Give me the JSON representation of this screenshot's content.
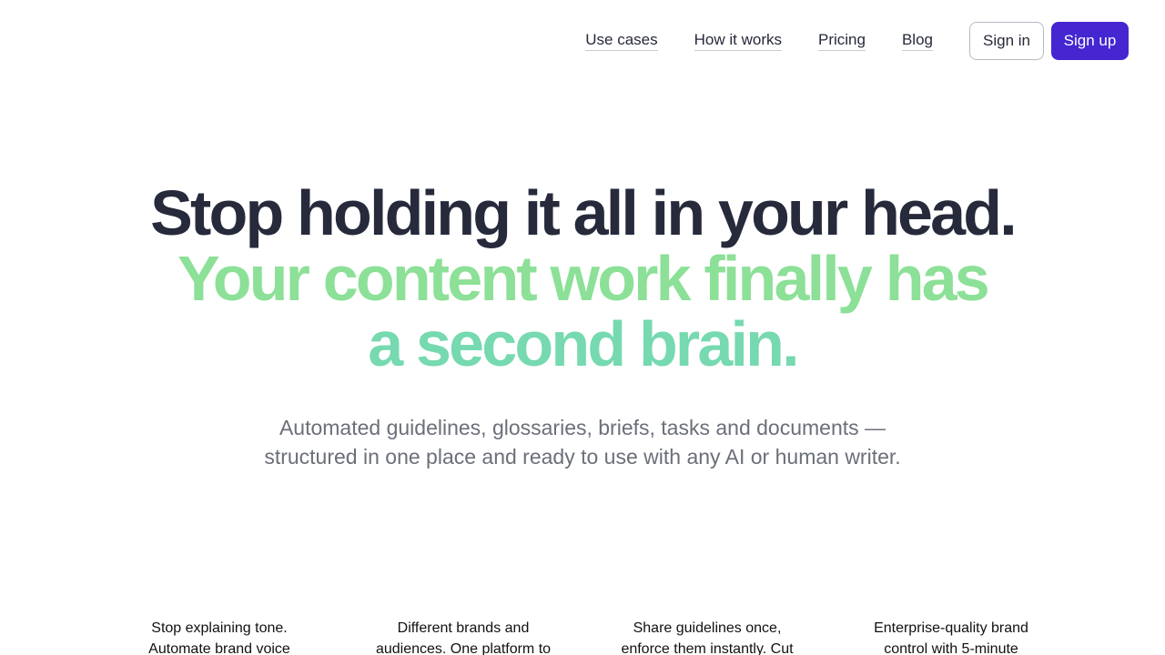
{
  "nav": {
    "links": [
      "Use cases",
      "How it works",
      "Pricing",
      "Blog"
    ],
    "signin_label": "Sign in",
    "signup_label": "Sign up"
  },
  "hero": {
    "line1": "Stop holding it all in your head.",
    "line2": "Your content work finally has",
    "line3": "a second brain."
  },
  "subtitle": {
    "line1": "Automated guidelines, glossaries, briefs, tasks and documents —",
    "line2": "structured in one place and ready to use with any AI or human writer."
  },
  "features": [
    "Stop explaining tone. Automate brand voice",
    "Different brands and audiences. One platform to",
    "Share guidelines once, enforce them instantly. Cut",
    "Enterprise-quality brand control with 5-minute"
  ],
  "colors": {
    "accent": "#4526d1",
    "headline_dark": "#262a3b",
    "headline_green": "#8ce097",
    "headline_teal": "#76d9b0",
    "subtitle_gray": "#6b6f78"
  }
}
